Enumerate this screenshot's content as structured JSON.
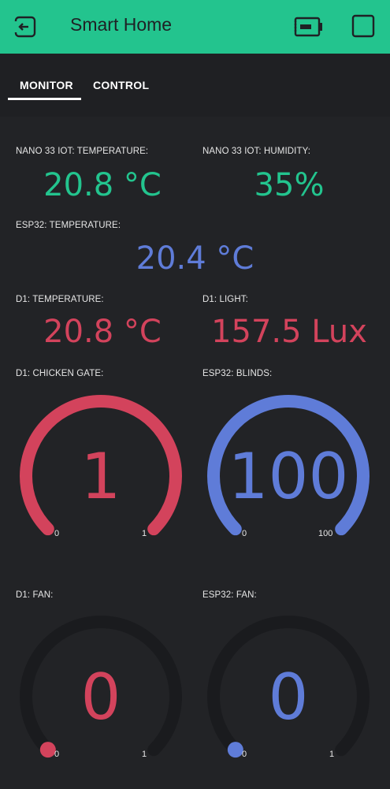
{
  "app": {
    "title": "Smart Home",
    "accent": "#23c48e",
    "icons": {
      "back": "exit-icon",
      "battery": "battery-icon",
      "square": "square-icon"
    }
  },
  "tabs": [
    {
      "label": "MONITOR",
      "active": true
    },
    {
      "label": "CONTROL",
      "active": false
    }
  ],
  "displays": {
    "nano_temp": {
      "label": "NANO 33 IOT: TEMPERATURE:",
      "value": "20.8 °C",
      "color": "#23c48e"
    },
    "nano_hum": {
      "label": "NANO 33 IOT: HUMIDITY:",
      "value": "35%",
      "color": "#23c48e"
    },
    "esp_temp": {
      "label": "ESP32: TEMPERATURE:",
      "value": "20.4 °C",
      "color": "#5f7cd8"
    },
    "d1_temp": {
      "label": "D1: TEMPERATURE:",
      "value": "20.8 °C",
      "color": "#d3435c"
    },
    "d1_light": {
      "label": "D1: LIGHT:",
      "value": "157.5 Lux",
      "color": "#d3435c"
    }
  },
  "gauges": {
    "chicken_gate": {
      "label": "D1: CHICKEN GATE:",
      "value": "1",
      "min": "0",
      "max": "1",
      "level": 1,
      "color": "#d3435c"
    },
    "esp_blinds": {
      "label": "ESP32: BLINDS:",
      "value": "100",
      "min": "0",
      "max": "100",
      "level": 1,
      "color": "#5f7cd8"
    },
    "d1_fan": {
      "label": "D1: FAN:",
      "value": "0",
      "min": "0",
      "max": "1",
      "level": 0,
      "color": "#d3435c"
    },
    "esp_fan": {
      "label": "ESP32: FAN:",
      "value": "0",
      "min": "0",
      "max": "1",
      "level": 0,
      "color": "#5f7cd8"
    }
  }
}
